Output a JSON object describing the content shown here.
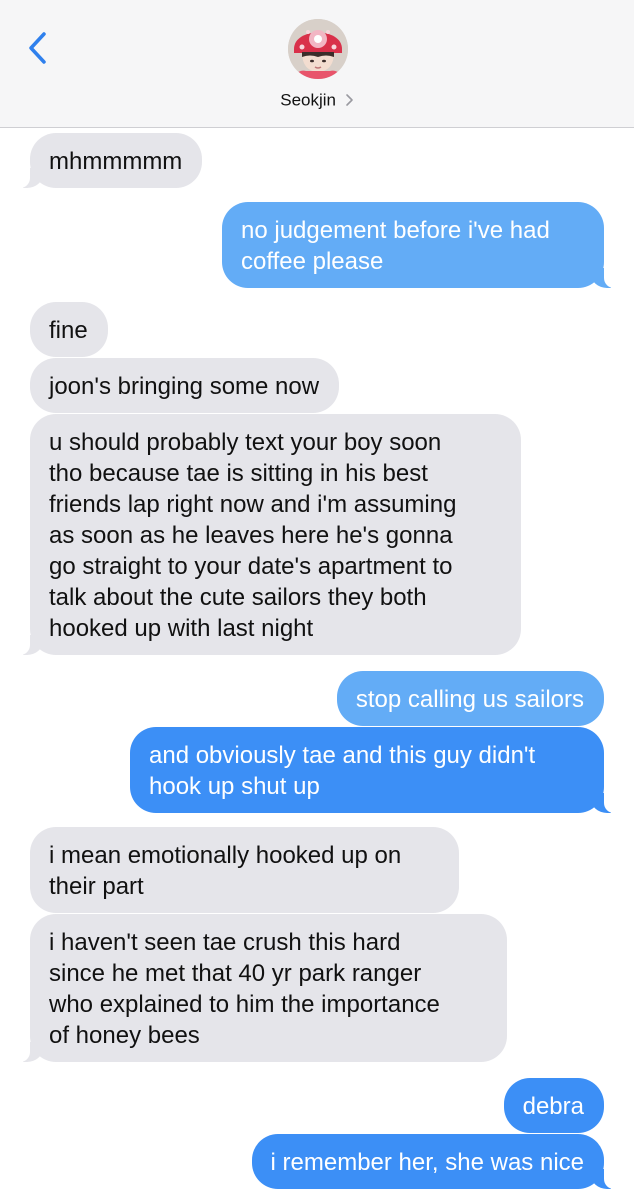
{
  "header": {
    "contact_name": "Seokjin",
    "chevron": "›"
  },
  "icons": {
    "back": "chevron-left-icon",
    "contact_chevron": "chevron-right-icon"
  },
  "colors": {
    "incoming_bubble": "#e5e5ea",
    "outgoing_bubble": "#3c8ff6",
    "outgoing_bubble_light": "#63acf6",
    "accent": "#2f80ed"
  },
  "messages": [
    {
      "from": "contact",
      "text": "mhmmmmm"
    },
    {
      "from": "me",
      "text": "no judgement before i've had\ncoffee please"
    },
    {
      "from": "contact",
      "text": "fine"
    },
    {
      "from": "contact",
      "text": "joon's bringing some now"
    },
    {
      "from": "contact",
      "text": "u should probably text your boy soon\ntho because tae is sitting in his best\nfriends lap right now and i'm assuming\nas soon as he leaves here he's gonna\ngo straight to your date's apartment to\ntalk about the cute sailors they both\nhooked up with last night"
    },
    {
      "from": "me",
      "text": "stop calling us sailors"
    },
    {
      "from": "me",
      "text": "and obviously tae and this guy didn't\nhook up shut up"
    },
    {
      "from": "contact",
      "text": "i mean emotionally hooked up on\ntheir part"
    },
    {
      "from": "contact",
      "text": "i haven't seen tae crush this hard\nsince he met that 40 yr park ranger\nwho explained to him the importance\nof honey bees"
    },
    {
      "from": "me",
      "text": "debra"
    },
    {
      "from": "me",
      "text": "i remember her, she was nice"
    }
  ]
}
